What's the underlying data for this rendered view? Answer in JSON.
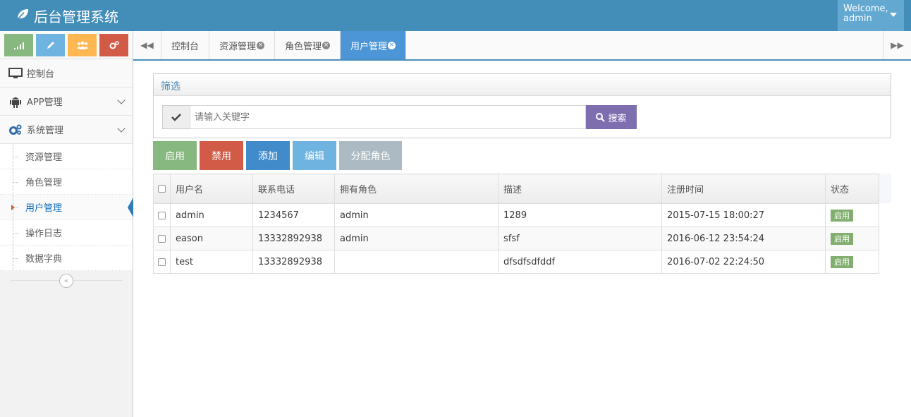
{
  "app": {
    "title": "后台管理系统",
    "welcome_line1": "Welcome,",
    "welcome_line2": "admin"
  },
  "shortcuts": [
    {
      "icon": "signal-icon",
      "color": "#87b87f"
    },
    {
      "icon": "pencil-icon",
      "color": "#6fb3e0"
    },
    {
      "icon": "users-icon",
      "color": "#ffb752"
    },
    {
      "icon": "cogs-icon",
      "color": "#d15b47"
    }
  ],
  "sidebar": {
    "dashboard": "控制台",
    "app_mgmt": "APP管理",
    "system_mgmt": "系统管理",
    "sub_items": [
      "资源管理",
      "角色管理",
      "用户管理",
      "操作日志",
      "数据字典"
    ],
    "active_sub": "用户管理"
  },
  "tabs": {
    "items": [
      "控制台",
      "资源管理",
      "角色管理",
      "用户管理"
    ],
    "active": "用户管理"
  },
  "filter": {
    "title": "筛选",
    "placeholder": "请输入关键字",
    "search_label": "搜索"
  },
  "actions": {
    "enable": "启用",
    "disable": "禁用",
    "add": "添加",
    "edit": "编辑",
    "assign_role": "分配角色"
  },
  "table": {
    "columns": [
      "用户名",
      "联系电话",
      "拥有角色",
      "描述",
      "注册时间",
      "状态"
    ],
    "rows": [
      {
        "username": "admin",
        "phone": "1234567",
        "role": "admin",
        "desc": "1289",
        "registered": "2015-07-15 18:00:27",
        "status": "启用"
      },
      {
        "username": "eason",
        "phone": "13332892938",
        "role": "admin",
        "desc": "sfsf",
        "registered": "2016-06-12 23:54:24",
        "status": "启用"
      },
      {
        "username": "test",
        "phone": "13332892938",
        "role": "",
        "desc": "dfsdfsdfddf",
        "registered": "2016-07-02 22:24:50",
        "status": "启用"
      }
    ]
  },
  "colors": {
    "navbar": "#438eb9",
    "accent": "#4c8fbd",
    "status_active": "#82af6f"
  }
}
